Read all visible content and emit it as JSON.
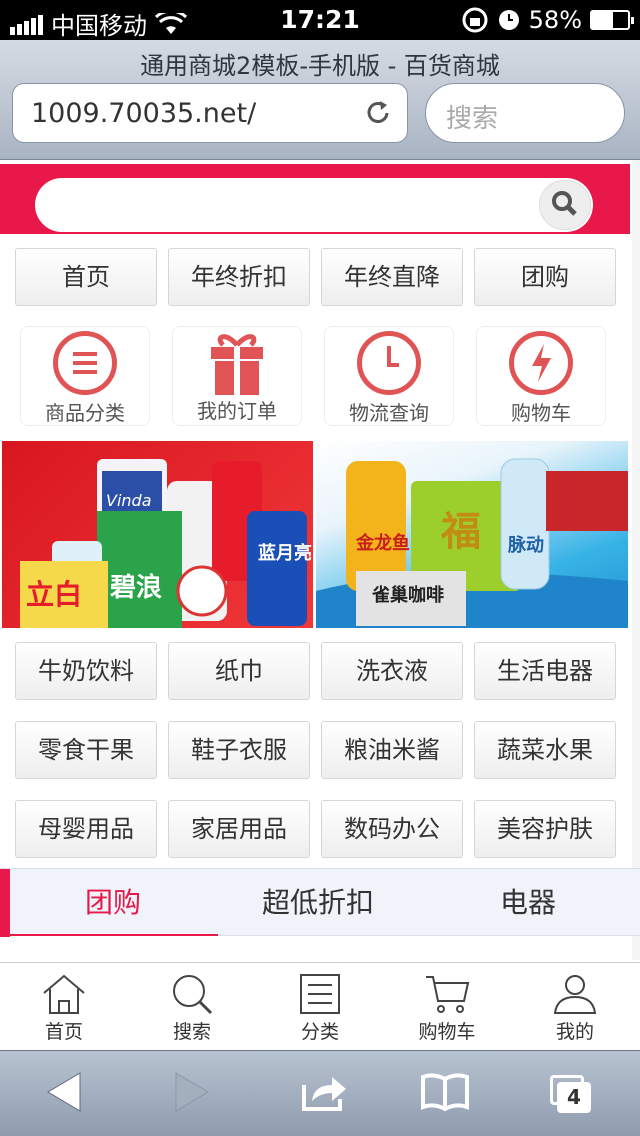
{
  "status": {
    "carrier": "中国移动",
    "time": "17:21",
    "battery": "58%",
    "battery_level": 0.58
  },
  "browser": {
    "title": "通用商城2模板-手机版 - 百货商城",
    "url": "1009.70035.net/",
    "search_placeholder": "搜索",
    "tabs_count": "4"
  },
  "site_search": {
    "placeholder": ""
  },
  "nav_buttons": [
    "首页",
    "年终折扣",
    "年终直降",
    "团购"
  ],
  "icon_links": [
    {
      "label": "商品分类",
      "icon": "list-icon"
    },
    {
      "label": "我的订单",
      "icon": "gift-icon"
    },
    {
      "label": "物流查询",
      "icon": "clock-icon"
    },
    {
      "label": "购物车",
      "icon": "lightning-icon"
    }
  ],
  "categories": [
    "牛奶饮料",
    "纸巾",
    "洗衣液",
    "生活电器",
    "零食干果",
    "鞋子衣服",
    "粮油米酱",
    "蔬菜水果",
    "母婴用品",
    "家居用品",
    "数码办公",
    "美容护肤"
  ],
  "banner_texts": {
    "b1_logo": "立白",
    "b1_p1": "碧浪",
    "b1_p2": "蓝月亮",
    "b1_vinda": "Vinda",
    "b2_p1": "金龙鱼",
    "b2_p2": "福",
    "b2_p3": "雀巢咖啡",
    "b2_p4": "脉动"
  },
  "tabs": [
    "团购",
    "超低折扣",
    "电器"
  ],
  "footer": [
    "首页",
    "搜索",
    "分类",
    "购物车",
    "我的"
  ],
  "colors": {
    "brand": "#e8194a",
    "icon": "#e05456"
  }
}
